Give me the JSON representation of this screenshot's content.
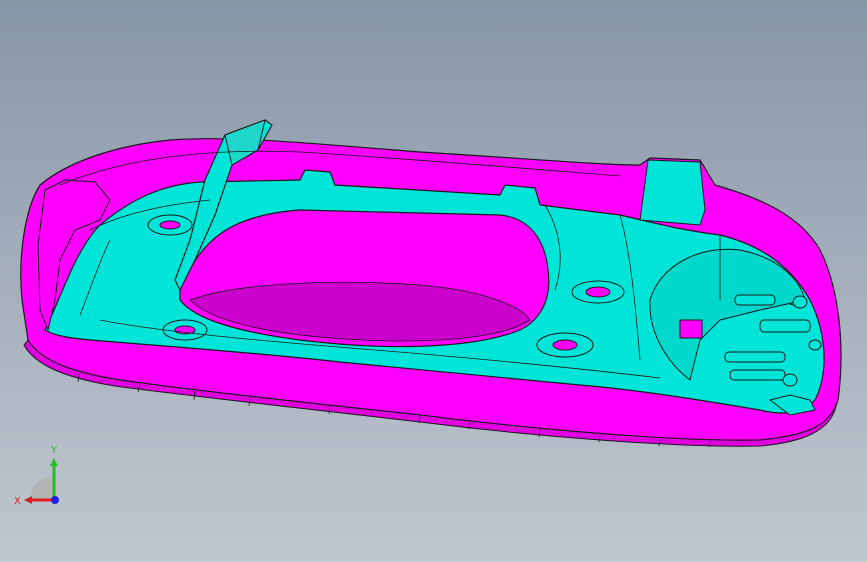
{
  "viewport": {
    "background_top": "#8796a8",
    "background_bottom": "#c0c7cf"
  },
  "model": {
    "part_color": "#ff00ff",
    "insert_color": "#00e5d8",
    "edge_color": "#1a1a1a"
  },
  "triad": {
    "x_label": "X",
    "y_label": "Y",
    "x_color": "#e02020",
    "y_color": "#20c020",
    "z_color": "#2020e0"
  }
}
